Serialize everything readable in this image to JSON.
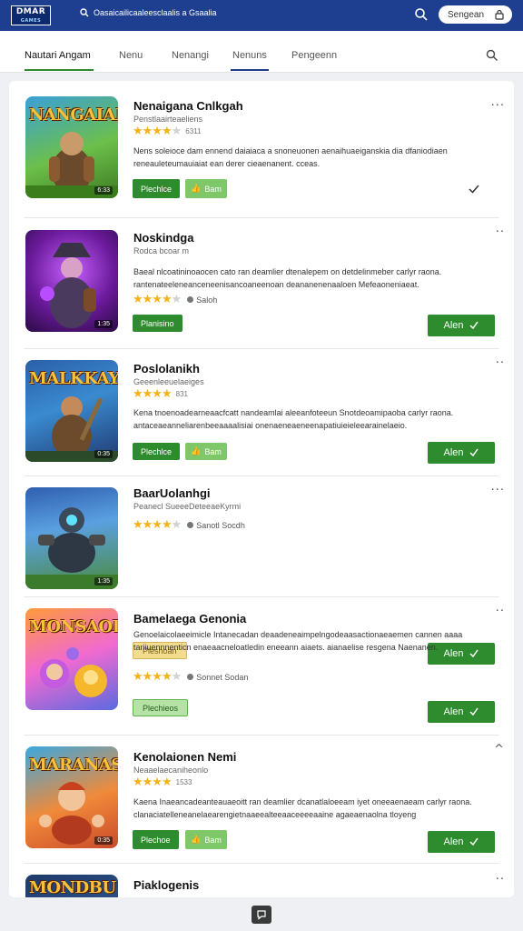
{
  "header": {
    "logo_line1": "DMAR",
    "logo_line2": "GAMES",
    "search_text": "Oasaicailicaaleesclaalis a Gsaalia",
    "sign_in_label": "Sengean",
    "brand_color": "#1e3f8f"
  },
  "tabs": [
    {
      "label": "Nautari Angam",
      "active": true,
      "underline_color": "#2e8b2e"
    },
    {
      "label": "Nenu",
      "active": false
    },
    {
      "label": "Nenangi",
      "active": false
    },
    {
      "label": "Nenuns",
      "active": false,
      "underline_color": "#1e3f8f"
    },
    {
      "label": "Pengeenn",
      "active": false
    }
  ],
  "games": [
    {
      "title": "Nenaigana Cnlkgah",
      "subtitle": "Penstlaairteaeliens",
      "stars": 4,
      "rating_count": "6311",
      "rating_meta": "",
      "description": "Nens soleioce dam ennend daiaiaca a snoneuonen aenaihuaeiganskia dia dfaniodiaen reneauleteumauiaiat ean derer cieaenanent. cceas.",
      "thumb_title": "NANGAIAN",
      "thumb_badge": "6:33",
      "primary_btn": "Plechlce",
      "secondary_btn": "Bam",
      "action_btn": "",
      "accent": "#2e8b2e"
    },
    {
      "title": "Noskindga",
      "subtitle": "Rodca bcoar m",
      "stars": 4,
      "rating_count": "",
      "rating_meta": "Saloh",
      "description": "Baeal nlcoatininoaocen cato ran deamlier dtenalepem on detdelinmeber carlyr raona. rantenateeleneanceneenisancoaneenoan deananenenaaloen Mefeaoneniaeat.",
      "thumb_title": "",
      "thumb_badge": "1:35",
      "primary_btn": "Planisino",
      "secondary_btn": "",
      "action_btn": "Alen",
      "accent": "#2e8b2e"
    },
    {
      "title": "Poslolanikh",
      "subtitle": "Geeenleeuelaeiges",
      "stars": 4,
      "rating_count": "831",
      "rating_meta": "",
      "description": "Kena tnoenoadearneaacfcatt nandeamlai aleeanfoteeun Snotdeoamipaoba carlyr raona. antaceaeanneliarenbeeaaaalisiai onenaeneaeneenapatiuieieleearainelaeio.",
      "thumb_title": "MALKKAY",
      "thumb_badge": "0:35",
      "primary_btn": "Plechlce",
      "secondary_btn": "Bam",
      "action_btn": "Alen",
      "accent": "#2e8b2e"
    },
    {
      "title": "BaarUolanhgi",
      "subtitle": "Peanecl SueeeDeteeaeKyrmi",
      "stars": 4,
      "rating_count": "",
      "rating_meta": "Sanotl Socdh",
      "description": "",
      "thumb_title": "",
      "thumb_badge": "1:35",
      "primary_btn": "Pleshoan",
      "secondary_btn": "",
      "action_btn": "Alen",
      "accent": "#f4dc8e"
    },
    {
      "title": "Bamelaega Genonia",
      "subtitle": "",
      "stars": 4,
      "rating_count": "",
      "rating_meta": "Sonnet Sodan",
      "description": "Genoelaicolaeeimicle Intanecadan deaadeneaimpelngodeaasactionaeaemen cannen aaaa tariiuennnenticn enaeaacneloatledin eneeann aiaets. aianaelise resgena Naenanen.",
      "thumb_title": "MONSAOIS",
      "thumb_badge": "",
      "primary_btn": "Plechieos",
      "secondary_btn": "",
      "action_btn": "Alen",
      "accent": "#b5e3a6"
    },
    {
      "title": "Kenolaionen Nemi",
      "subtitle": "Neaaelaecaniheonlo",
      "stars": 4,
      "rating_count": "1533",
      "rating_meta": "",
      "description": "Kaena Inaeancadeanteauaeoitt ran deamlier dcanatlaloeeam iyet oneeaenaeam carlyr raona. clanaciatelleneanelaearengietnaaeealteeaaceeeeaaine agaeaenaolna tloyeng",
      "thumb_title": "MARANAS",
      "thumb_badge": "0:35",
      "primary_btn": "Plechoe",
      "secondary_btn": "Bam",
      "action_btn": "Alen",
      "accent": "#2e8b2e"
    },
    {
      "title": "Piaklogenis",
      "subtitle": "",
      "stars": 0,
      "rating_count": "",
      "rating_meta": "",
      "description": "",
      "thumb_title": "MONDBU",
      "thumb_badge": "",
      "primary_btn": "",
      "secondary_btn": "",
      "action_btn": "",
      "accent": "#2e8b2e"
    }
  ],
  "colors": {
    "primary_green": "#2e8b2e",
    "star_yellow": "#f2b31c",
    "header_blue": "#1e3f8f"
  }
}
